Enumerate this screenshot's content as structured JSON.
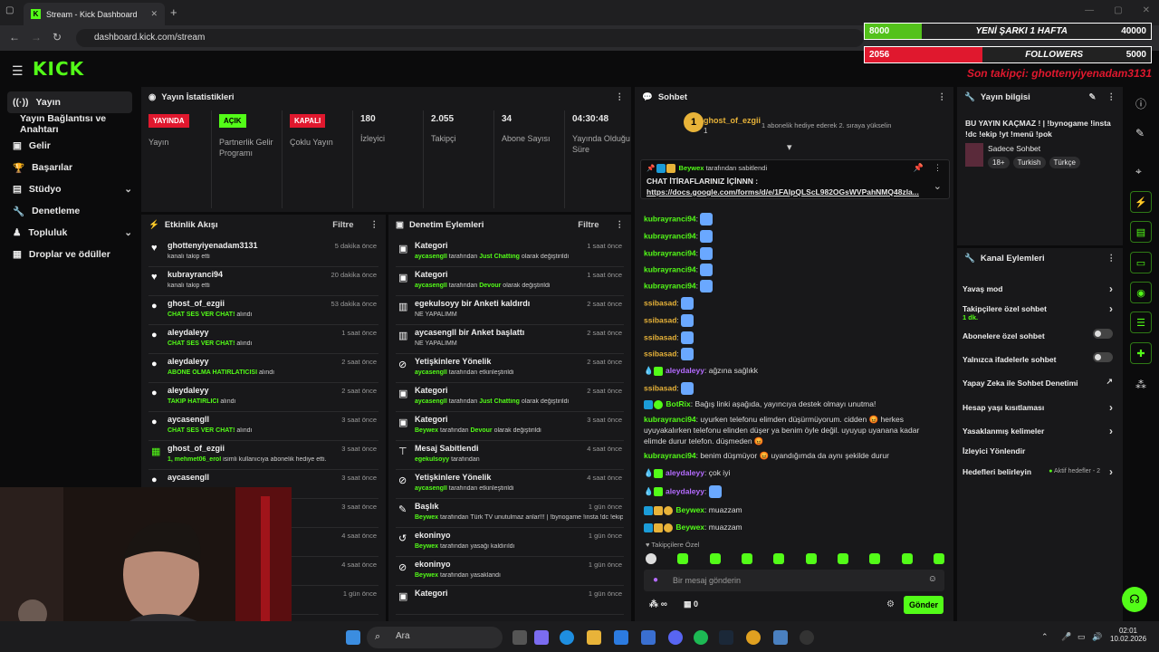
{
  "browser": {
    "tab_title": "Stream - Kick Dashboard",
    "url": "dashboard.kick.com/stream"
  },
  "overlay": {
    "bar1": {
      "left": "8000",
      "mid": "YENİ ŞARKI 1 HAFTA",
      "right": "40000",
      "progress": 0.2
    },
    "bar2": {
      "left": "2056",
      "mid": "FOLLOWERS",
      "right": "5000",
      "progress": 0.41
    },
    "last_follower": "Son takipçi: ghottenyiyenadam3131"
  },
  "kick": {
    "logo": "KICK"
  },
  "sidebar": {
    "items": [
      {
        "label": "Yayın",
        "icon": "broadcast-icon"
      },
      {
        "label": "Yayın Bağlantısı ve Anahtarı",
        "icon": ""
      },
      {
        "label": "Gelir",
        "icon": "money-icon"
      },
      {
        "label": "Başarılar",
        "icon": "trophy-icon"
      },
      {
        "label": "Stüdyo",
        "icon": "studio-icon"
      },
      {
        "label": "Denetleme",
        "icon": "wrench-icon"
      },
      {
        "label": "Topluluk",
        "icon": "community-icon"
      },
      {
        "label": "Droplar ve ödüller",
        "icon": "gift-icon"
      }
    ]
  },
  "stats": {
    "title": "Yayın İstatistikleri",
    "items": [
      {
        "badge": "YAYINDA",
        "label": "Yayın",
        "color": "#e0182e"
      },
      {
        "badge": "AÇIK",
        "label": "Partnerlik Gelir Programı",
        "color": "#53fc18"
      },
      {
        "badge": "KAPALI",
        "label": "Çoklu Yayın",
        "color": "#e0182e"
      },
      {
        "value": "180",
        "label": "İzleyici"
      },
      {
        "value": "2.055",
        "label": "Takipçi"
      },
      {
        "value": "34",
        "label": "Abone Sayısı"
      },
      {
        "value": "04:30:48",
        "label": "Yayında Olduğu Süre"
      }
    ]
  },
  "activity": {
    "title": "Etkinlik Akışı",
    "filter": "Filtre",
    "rows": [
      {
        "name": "ghottenyiyenadam3131",
        "sub": "",
        "sub2": "kanalı takip etti",
        "time": "5 dakika önce"
      },
      {
        "name": "kubrayranci94",
        "sub": "",
        "sub2": "kanalı takip etti",
        "time": "20 dakika önce"
      },
      {
        "name": "ghost_of_ezgii",
        "sub": "CHAT SES VER CHAT!",
        "sub2": " alındı",
        "time": "53 dakika önce"
      },
      {
        "name": "aleydaleyy",
        "sub": "CHAT SES VER CHAT!",
        "sub2": " alındı",
        "time": "1 saat önce"
      },
      {
        "name": "aleydaleyy",
        "sub": "ABONE OLMA HATIRLATICISI",
        "sub2": " alındı",
        "time": "2 saat önce"
      },
      {
        "name": "aleydaleyy",
        "sub": "TAKİP HATIRLICI",
        "sub2": " alındı",
        "time": "2 saat önce"
      },
      {
        "name": "aycasengll",
        "sub": "CHAT SES VER CHAT!",
        "sub2": " alındı",
        "time": "3 saat önce"
      },
      {
        "name": "ghost_of_ezgii",
        "sub": "1, mehmet06_erol",
        "sub2": " isimli kullanıcıya abonelik hediye etti.",
        "time": "3 saat önce"
      },
      {
        "name": "aycasengll",
        "sub": "",
        "sub2": "",
        "time": "3 saat önce"
      },
      {
        "name": "",
        "sub": "",
        "sub2": "",
        "time": "3 saat önce"
      },
      {
        "name": "",
        "sub": "",
        "sub2": "",
        "time": "4 saat önce"
      },
      {
        "name": "",
        "sub": "",
        "sub2": "",
        "time": "4 saat önce"
      },
      {
        "name": "",
        "sub": "",
        "sub2": "",
        "time": "1 gün önce"
      }
    ]
  },
  "modlog": {
    "title": "Denetim Eylemleri",
    "filter": "Filtre",
    "rows": [
      {
        "title": "Kategori",
        "user": "aycasengll",
        "text": " tarafından ",
        "hl": "Just Chatting",
        "tail": " olarak değiştirildi",
        "time": "1 saat önce",
        "icon": "category-icon"
      },
      {
        "title": "Kategori",
        "user": "aycasengll",
        "text": " tarafından ",
        "hl": "Devour",
        "tail": " olarak değiştirildi",
        "time": "1 saat önce",
        "icon": "category-icon"
      },
      {
        "title": "egekulsoyy bir Anketi kaldırdı",
        "user": "",
        "text": "NE YAPALIMM",
        "hl": "",
        "tail": "",
        "time": "2 saat önce",
        "icon": "poll-icon"
      },
      {
        "title": "aycasengll bir Anket başlattı",
        "user": "",
        "text": "NE YAPALIMM",
        "hl": "",
        "tail": "",
        "time": "2 saat önce",
        "icon": "poll-icon"
      },
      {
        "title": "Yetişkinlere Yönelik",
        "user": "aycasengll",
        "text": " tarafından etkinleştirildi",
        "hl": "",
        "tail": "",
        "time": "2 saat önce",
        "icon": "eye-off-icon"
      },
      {
        "title": "Kategori",
        "user": "aycasengll",
        "text": " tarafından ",
        "hl": "Just Chatting",
        "tail": " olarak değiştirildi",
        "time": "2 saat önce",
        "icon": "category-icon"
      },
      {
        "title": "Kategori",
        "user": "Beywex",
        "text": " tarafından ",
        "hl": "Devour",
        "tail": " olarak değiştirildi",
        "time": "3 saat önce",
        "icon": "category-icon"
      },
      {
        "title": "Mesaj Sabitlendi",
        "user": "egekulsoyy",
        "text": " tarafından",
        "hl": "",
        "tail": "",
        "time": "4 saat önce",
        "icon": "pin-icon"
      },
      {
        "title": "Yetişkinlere Yönelik",
        "user": "aycasengll",
        "text": " tarafından etkinleştirildi",
        "hl": "",
        "tail": "",
        "time": "4 saat önce",
        "icon": "eye-off-icon"
      },
      {
        "title": "Başlık",
        "user": "Beywex",
        "text": " tarafından Türk TV unutulmaz anlar!!! | !bynogame !insta !dc !ekip !yt !menü !pok",
        "hl": "",
        "tail": "",
        "time": "1 gün önce",
        "icon": "title-icon"
      },
      {
        "title": "ekoninyo",
        "user": "Beywex",
        "text": " tarafından yasağı kaldırıldı",
        "hl": "",
        "tail": "",
        "time": "1 gün önce",
        "icon": "unban-icon"
      },
      {
        "title": "ekoninyo",
        "user": "Beywex",
        "text": " tarafından yasaklandı",
        "hl": "",
        "tail": "",
        "time": "1 gün önce",
        "icon": "ban-icon"
      },
      {
        "title": "Kategori",
        "user": "",
        "text": "",
        "hl": "",
        "tail": "",
        "time": "1 gün önce",
        "icon": "category-icon"
      }
    ]
  },
  "chat": {
    "title": "Sohbet",
    "gift_user": "ghost_of_ezgii",
    "gift_count": "1",
    "gift_text": "1 abonelik hediye ederek 2. sıraya yükselin",
    "pinned_by": "Beywex",
    "pinned_by_text": "tarafından sabitlendi",
    "pinned_title": "CHAT İTİRAFLARINIZ İÇİNNN :",
    "pinned_link": "https://docs.google.com/forms/d/e/1FAIpQLScL982OGsWVPahNMQ48zla...",
    "lines": [
      {
        "user": "kubrayranci94",
        "color": "#53fc18",
        "msg": "",
        "emote": true
      },
      {
        "user": "kubrayranci94",
        "color": "#53fc18",
        "msg": "",
        "emote": true
      },
      {
        "user": "kubrayranci94",
        "color": "#53fc18",
        "msg": "",
        "emote": true
      },
      {
        "user": "kubrayranci94",
        "color": "#53fc18",
        "msg": "",
        "emote": true
      },
      {
        "user": "kubrayranci94",
        "color": "#53fc18",
        "msg": "",
        "emote": true
      },
      {
        "user": "ssibasad",
        "color": "#e8b339",
        "msg": "",
        "emote": true
      },
      {
        "user": "ssibasad",
        "color": "#e8b339",
        "msg": "",
        "emote": true
      },
      {
        "user": "ssibasad",
        "color": "#e8b339",
        "msg": "",
        "emote": true
      },
      {
        "user": "ssibasad",
        "color": "#e8b339",
        "msg": "",
        "emote": true
      },
      {
        "user": "aleydaleyy",
        "color": "#b46bff",
        "msg": "ağzına sağlıkk",
        "emote": false
      },
      {
        "user": "ssibasad",
        "color": "#e8b339",
        "msg": "",
        "emote": true
      },
      {
        "user": "BotRix",
        "color": "#53fc18",
        "msg": "Bağış linki aşağıda, yayıncıya destek olmayı unutma!",
        "emote": false
      },
      {
        "user": "kubrayranci94",
        "color": "#53fc18",
        "msg": "uyurken telefonu elimden düşürmüyorum. cidden 😡 herkes uyuyakalırken telefonu elinden düşer ya benim öyle değil. uyuyup uyanana kadar elimde durur telefon. düşmeden 😡",
        "emote": false
      },
      {
        "user": "kubrayranci94",
        "color": "#53fc18",
        "msg": "benim düşmüyor 😡 uyandığımda da aynı şekilde durur",
        "emote": false
      },
      {
        "user": "aleydaleyy",
        "color": "#b46bff",
        "msg": "çok iyi",
        "emote": false
      },
      {
        "user": "aleydaleyy",
        "color": "#b46bff",
        "msg": "",
        "emote": true
      },
      {
        "user": "Beywex",
        "color": "#53fc18",
        "msg": "muazzam",
        "emote": false
      },
      {
        "user": "Beywex",
        "color": "#53fc18",
        "msg": "muazzam",
        "emote": false
      }
    ],
    "followers_only": "Takipçilere Özel",
    "input_placeholder": "Bir mesaj gönderin",
    "points": "∞",
    "gifts": "0",
    "send": "Gönder"
  },
  "info": {
    "title": "Yayın bilgisi",
    "stream_title": "BU YAYIN KAÇMAZ ! | !bynogame !insta !dc !ekip !yt !menü !pok",
    "category": "Sadece Sohbet",
    "tags": [
      "18+",
      "Turkish",
      "Türkçe"
    ]
  },
  "actions": {
    "title": "Kanal Eylemleri",
    "items": [
      {
        "label": "Yavaş mod",
        "sub": "",
        "kind": "arrow"
      },
      {
        "label": "Takipçilere özel sohbet",
        "sub": "1 dk.",
        "kind": "arrow"
      },
      {
        "label": "Abonelere özel sohbet",
        "sub": "",
        "kind": "toggle"
      },
      {
        "label": "Yalnızca ifadelerle sohbet",
        "sub": "",
        "kind": "toggle"
      },
      {
        "label": "Yapay Zeka ile Sohbet Denetimi",
        "sub": "",
        "kind": "external"
      },
      {
        "label": "Hesap yaşı kısıtlaması",
        "sub": "",
        "kind": "arrow"
      },
      {
        "label": "Yasaklanmış kelimeler",
        "sub": "",
        "kind": "arrow"
      },
      {
        "label": "İzleyici Yönlendir",
        "sub": "",
        "kind": "none"
      },
      {
        "label": "Hedefleri belirleyin",
        "sub": "Aktif hedefler - 2",
        "kind": "arrow"
      }
    ]
  },
  "taskbar": {
    "search": "Ara",
    "time": "02:01",
    "date": "10.02.2026"
  }
}
